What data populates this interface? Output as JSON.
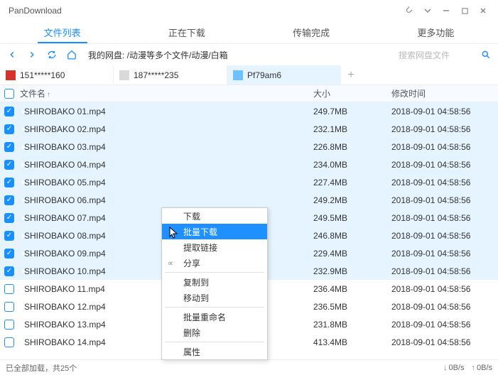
{
  "window": {
    "title": "PanDownload"
  },
  "tabs": [
    {
      "label": "文件列表",
      "active": true
    },
    {
      "label": "正在下载"
    },
    {
      "label": "传输完成"
    },
    {
      "label": "更多功能"
    }
  ],
  "nav": {
    "path": "我的网盘: /动漫等多个文件/动漫/白箱",
    "search_placeholder": "搜索网盘文件"
  },
  "accounts": [
    {
      "label": "151*****160",
      "color": "#d4322a"
    },
    {
      "label": "187*****235",
      "color": "#d9d9d9"
    },
    {
      "label": "Pf79am6",
      "color": "#6ec1ff",
      "active": true
    }
  ],
  "columns": {
    "name": "文件名",
    "size": "大小",
    "time": "修改时间"
  },
  "files": [
    {
      "name": "SHIROBAKO 01.mp4",
      "size": "249.7MB",
      "time": "2018-09-01 04:58:56",
      "checked": true
    },
    {
      "name": "SHIROBAKO 02.mp4",
      "size": "232.1MB",
      "time": "2018-09-01 04:58:56",
      "checked": true
    },
    {
      "name": "SHIROBAKO 03.mp4",
      "size": "226.8MB",
      "time": "2018-09-01 04:58:56",
      "checked": true
    },
    {
      "name": "SHIROBAKO 04.mp4",
      "size": "234.0MB",
      "time": "2018-09-01 04:58:56",
      "checked": true
    },
    {
      "name": "SHIROBAKO 05.mp4",
      "size": "227.4MB",
      "time": "2018-09-01 04:58:56",
      "checked": true
    },
    {
      "name": "SHIROBAKO 06.mp4",
      "size": "249.2MB",
      "time": "2018-09-01 04:58:56",
      "checked": true
    },
    {
      "name": "SHIROBAKO 07.mp4",
      "size": "249.5MB",
      "time": "2018-09-01 04:58:56",
      "checked": true
    },
    {
      "name": "SHIROBAKO 08.mp4",
      "size": "246.8MB",
      "time": "2018-09-01 04:58:56",
      "checked": true
    },
    {
      "name": "SHIROBAKO 09.mp4",
      "size": "229.4MB",
      "time": "2018-09-01 04:58:56",
      "checked": true
    },
    {
      "name": "SHIROBAKO 10.mp4",
      "size": "232.9MB",
      "time": "2018-09-01 04:58:56",
      "checked": true
    },
    {
      "name": "SHIROBAKO 11.mp4",
      "size": "236.4MB",
      "time": "2018-09-01 04:58:56",
      "checked": false
    },
    {
      "name": "SHIROBAKO 12.mp4",
      "size": "236.5MB",
      "time": "2018-09-01 04:58:56",
      "checked": false
    },
    {
      "name": "SHIROBAKO 13.mp4",
      "size": "231.8MB",
      "time": "2018-09-01 04:58:56",
      "checked": false
    },
    {
      "name": "SHIROBAKO 14.mp4",
      "size": "413.4MB",
      "time": "2018-09-01 04:58:56",
      "checked": false
    }
  ],
  "context_menu": {
    "items": [
      {
        "label": "下载"
      },
      {
        "label": "批量下载",
        "selected": true
      },
      {
        "label": "提取链接"
      },
      {
        "label": "分享",
        "icon": "share",
        "sep_after": true
      },
      {
        "label": "复制到"
      },
      {
        "label": "移动到",
        "sep_after": true
      },
      {
        "label": "批量重命名"
      },
      {
        "label": "删除",
        "sep_after": true
      },
      {
        "label": "属性"
      }
    ]
  },
  "status": {
    "text": "已全部加载，共25个",
    "speed_down": "0B/s",
    "speed_up": "0B/s"
  }
}
